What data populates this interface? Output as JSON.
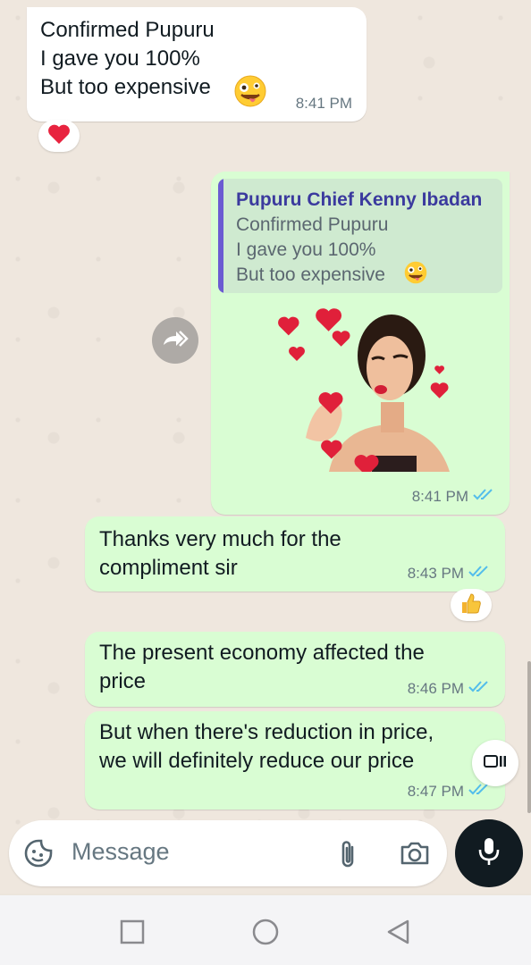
{
  "messages": [
    {
      "direction": "incoming",
      "lines": "Confirmed Pupuru\nI gave you 100%\nBut too expensive",
      "emoji": "zany-face",
      "time": "8:41 PM",
      "reaction": "heart"
    },
    {
      "direction": "outgoing",
      "quote_author": "Pupuru Chief Kenny Ibadan",
      "quote_text": "Confirmed Pupuru\nI gave you 100%\nBut too expensive",
      "quote_emoji": "zany-face",
      "attachment": "sticker-woman-with-hearts",
      "time": "8:41 PM",
      "status": "read"
    },
    {
      "direction": "outgoing",
      "text": "Thanks very much for the\ncompliment sir",
      "time": "8:43 PM",
      "status": "read",
      "reaction": "thumbs-up"
    },
    {
      "direction": "outgoing",
      "text": "The present economy affected the\nprice",
      "time": "8:46 PM",
      "status": "read"
    },
    {
      "direction": "outgoing",
      "text": "But when there's reduction in price,\nwe will definitely reduce our price",
      "time": "8:47 PM",
      "status": "read"
    }
  ],
  "composer": {
    "placeholder": "Message",
    "icons": [
      "sticker-icon",
      "attach-icon",
      "camera-icon",
      "mic-icon"
    ]
  },
  "navigation": {
    "buttons": [
      "recents-button",
      "home-button",
      "back-button"
    ]
  },
  "colors": {
    "incoming_bubble": "#ffffff",
    "outgoing_bubble": "#d9fdd3",
    "read_ticks": "#53bdeb",
    "quote_bar": "#6b5bd2",
    "wallpaper": "#efe7de"
  }
}
